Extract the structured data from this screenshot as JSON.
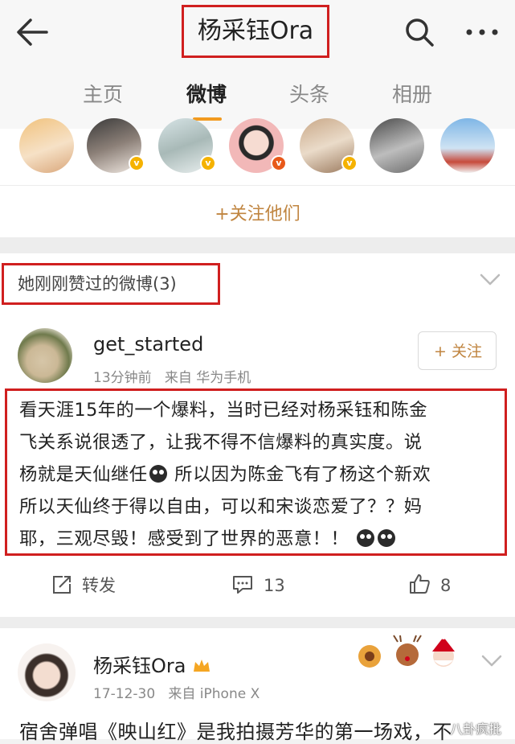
{
  "header": {
    "title": "杨采钰Ora",
    "back_icon": "back-arrow-icon",
    "search_icon": "search-icon",
    "more_icon": "more-icon"
  },
  "tabs": [
    {
      "label": "主页",
      "active": false
    },
    {
      "label": "微博",
      "active": true
    },
    {
      "label": "头条",
      "active": false
    },
    {
      "label": "相册",
      "active": false
    }
  ],
  "follow_strip": {
    "follow_them_label": "+关注他们",
    "avatar_count": 7
  },
  "liked_section": {
    "title": "她刚刚赞过的微博(3)",
    "post": {
      "username": "get_started",
      "time": "13分钟前",
      "source": "来自 华为手机",
      "follow_label": "+ 关注",
      "text_lines": [
        "看天涯15年的一个爆料，当时已经对杨采钰和陈金",
        "飞关系说很透了，让我不得不信爆料的真实度。说",
        "杨就是天仙继任",
        " 所以因为陈金飞有了杨这个新欢",
        "所以天仙终于得以自由，可以和宋谈恋爱了？？妈",
        "耶，三观尽毁！感受到了世界的恶意！！"
      ],
      "repost_label": "转发",
      "comment_count": "13",
      "like_count": "8"
    }
  },
  "second_post": {
    "username": "杨采钰Ora",
    "time": "17-12-30",
    "source": "来自 iPhone X",
    "text": "宿舍弹唱《映山红》是我拍摄芳华的第一场戏，不"
  },
  "watermark": "八卦疯批",
  "colors": {
    "accent_gold": "#c08540",
    "tab_underline": "#f29a1f",
    "highlight_red": "#d01f1f",
    "badge_yellow": "#f5b200"
  }
}
